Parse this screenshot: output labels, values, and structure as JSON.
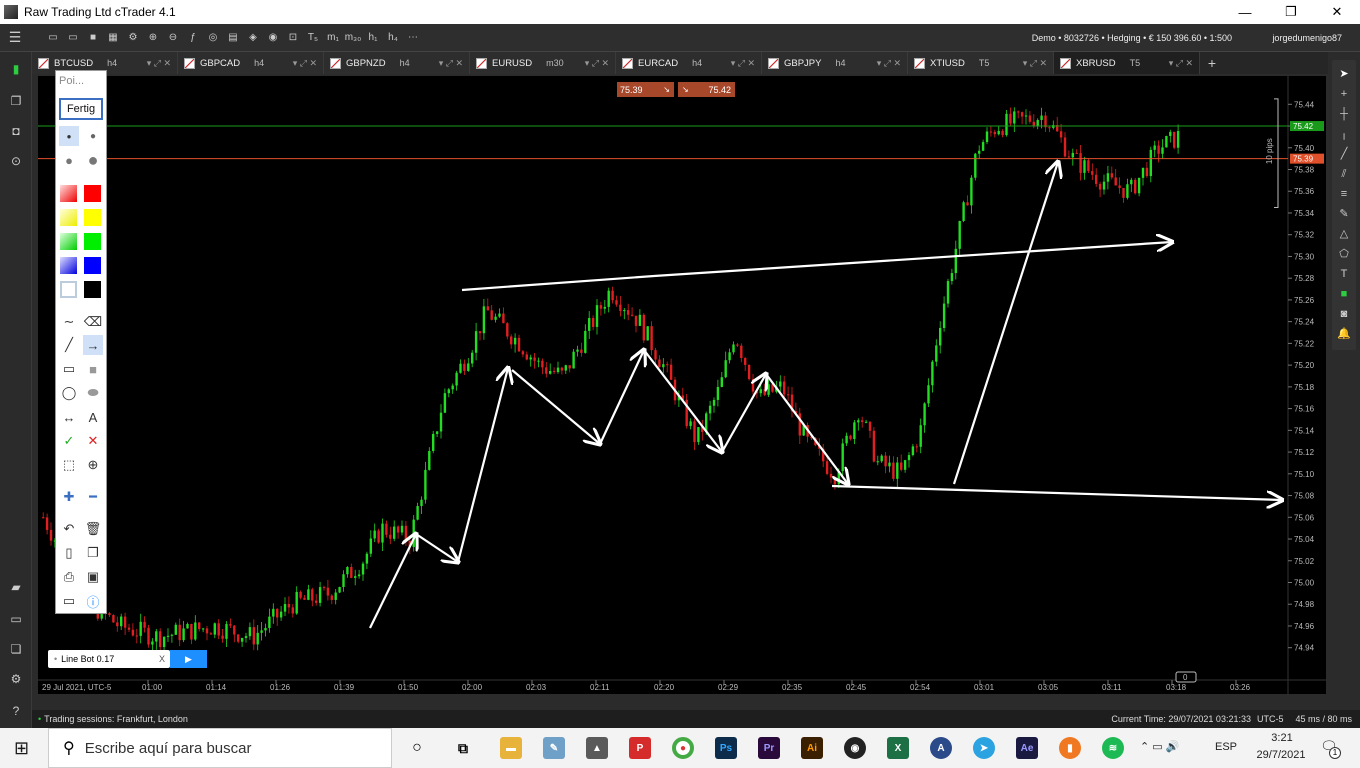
{
  "window": {
    "title": "Raw Trading Ltd cTrader 4.1"
  },
  "account": {
    "info": "Demo • 8032726 • Hedging • € 150 396.60 • 1:500",
    "user": "jorgedumenigo87"
  },
  "tabs": [
    {
      "symbol": "BTCUSD",
      "tf": "h4"
    },
    {
      "symbol": "GBPCAD",
      "tf": "h4"
    },
    {
      "symbol": "GBPNZD",
      "tf": "h4"
    },
    {
      "symbol": "EURUSD",
      "tf": "m30"
    },
    {
      "symbol": "EURCAD",
      "tf": "h4"
    },
    {
      "symbol": "GBPJPY",
      "tf": "h4"
    },
    {
      "symbol": "XTIUSD",
      "tf": "T5"
    },
    {
      "symbol": "XBRUSD",
      "tf": "T5"
    }
  ],
  "quote": {
    "sell": "75.39",
    "buy": "75.42"
  },
  "drawing_panel": {
    "title": "Poi...",
    "done_label": "Fertig"
  },
  "bot": {
    "label": "Line Bot 0.17",
    "close": "X"
  },
  "chart_data": {
    "type": "candlestick",
    "symbol": "XBRUSD",
    "date_label": "29 Jul 2021, UTC-5",
    "x_ticks": [
      "01:00",
      "01:14",
      "01:26",
      "01:39",
      "01:50",
      "02:00",
      "02:03",
      "02:11",
      "02:20",
      "02:29",
      "02:35",
      "02:45",
      "02:54",
      "03:01",
      "03:05",
      "03:11",
      "03:18",
      "03:26"
    ],
    "y_ticks": [
      "75.44",
      "75.42",
      "75.40",
      "75.38",
      "75.36",
      "75.34",
      "75.32",
      "75.30",
      "75.28",
      "75.26",
      "75.24",
      "75.22",
      "75.20",
      "75.18",
      "75.16",
      "75.14",
      "75.12",
      "75.10",
      "75.08",
      "75.06",
      "75.04",
      "75.02",
      "75.00",
      "74.98",
      "74.96",
      "74.94"
    ],
    "ylim": [
      74.925,
      75.455
    ],
    "bid": "75.39",
    "ask": "75.42",
    "pips_label": "10 pips",
    "scroll_badge": "0",
    "colors": {
      "up": "#22dd22",
      "down": "#e02020",
      "ask_line": "#1a9a1a",
      "bid_line": "#e0502a"
    }
  },
  "status": {
    "sessions": "Trading sessions: Frankfurt, London",
    "time": "Current Time: 29/07/2021 03:21:33",
    "tz": "UTC-5",
    "latency": "45 ms / 80 ms"
  },
  "taskbar": {
    "search_placeholder": "Escribe aquí para buscar",
    "lang": "ESP",
    "time": "3:21",
    "date": "29/7/2021",
    "notif": "1"
  }
}
